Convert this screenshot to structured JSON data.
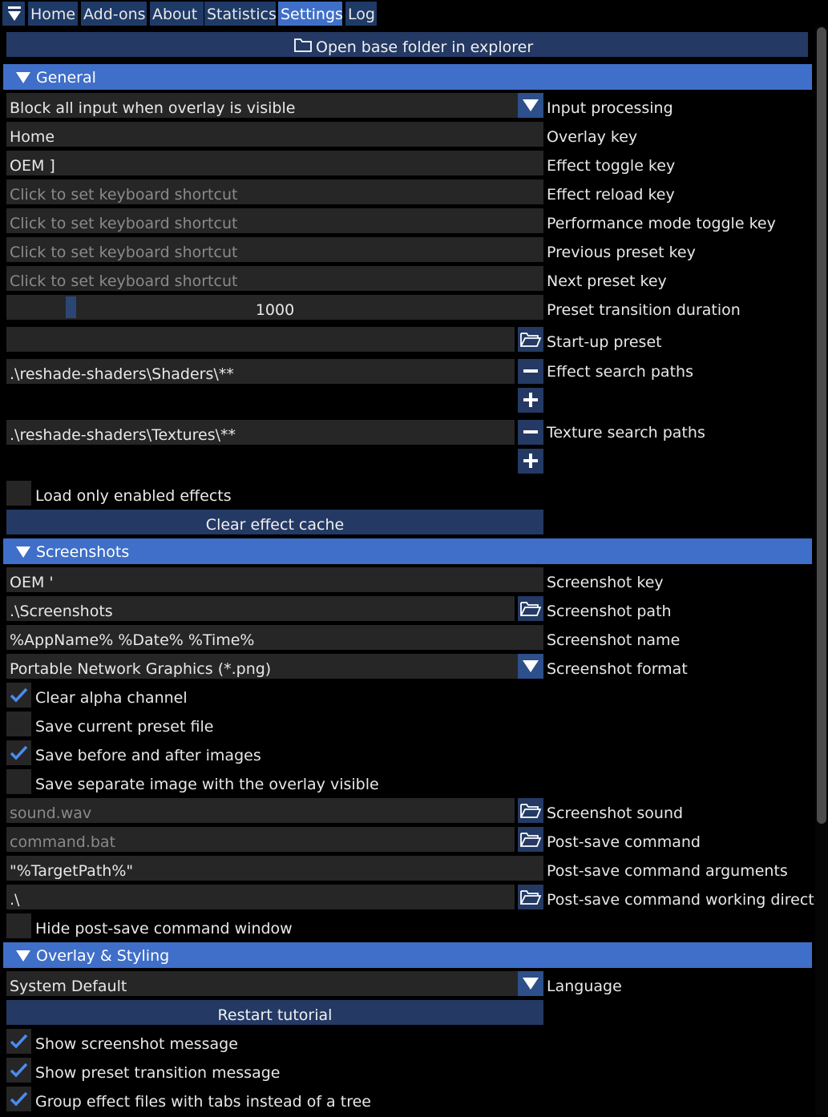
{
  "tabs": [
    "Home",
    "Add-ons",
    "About",
    "Statistics",
    "Settings",
    "Log"
  ],
  "active_tab": "Settings",
  "open_folder_label": "Open base folder in explorer",
  "general": {
    "header": "General",
    "input_processing": {
      "value": "Block all input when overlay is visible",
      "label": "Input processing"
    },
    "overlay_key": {
      "value": "Home",
      "label": "Overlay key"
    },
    "effect_toggle_key": {
      "value": "OEM ]",
      "label": "Effect toggle key"
    },
    "effect_reload_key": {
      "placeholder": "Click to set keyboard shortcut",
      "label": "Effect reload key"
    },
    "performance_mode_key": {
      "placeholder": "Click to set keyboard shortcut",
      "label": "Performance mode toggle key"
    },
    "previous_preset_key": {
      "placeholder": "Click to set keyboard shortcut",
      "label": "Previous preset key"
    },
    "next_preset_key": {
      "placeholder": "Click to set keyboard shortcut",
      "label": "Next preset key"
    },
    "preset_transition": {
      "value": "1000",
      "label": "Preset transition duration"
    },
    "startup_preset": {
      "value": "",
      "label": "Start-up preset"
    },
    "effect_search_paths": {
      "value": ".\\reshade-shaders\\Shaders\\**",
      "label": "Effect search paths"
    },
    "texture_search_paths": {
      "value": ".\\reshade-shaders\\Textures\\**",
      "label": "Texture search paths"
    },
    "load_only_enabled": {
      "label": "Load only enabled effects",
      "checked": false
    },
    "clear_cache_label": "Clear effect cache"
  },
  "screenshots": {
    "header": "Screenshots",
    "screenshot_key": {
      "value": "OEM '",
      "label": "Screenshot key"
    },
    "screenshot_path": {
      "value": ".\\Screenshots",
      "label": "Screenshot path"
    },
    "screenshot_name": {
      "value": "%AppName% %Date% %Time%",
      "label": "Screenshot name"
    },
    "screenshot_format": {
      "value": "Portable Network Graphics (*.png)",
      "label": "Screenshot format"
    },
    "clear_alpha": {
      "label": "Clear alpha channel",
      "checked": true
    },
    "save_preset": {
      "label": "Save current preset file",
      "checked": false
    },
    "save_before_after": {
      "label": "Save before and after images",
      "checked": true
    },
    "save_overlay": {
      "label": "Save separate image with the overlay visible",
      "checked": false
    },
    "screenshot_sound": {
      "placeholder": "sound.wav",
      "label": "Screenshot sound"
    },
    "post_save_command": {
      "placeholder": "command.bat",
      "label": "Post-save command"
    },
    "post_save_args": {
      "value": "\"%TargetPath%\"",
      "label": "Post-save command arguments"
    },
    "post_save_dir": {
      "value": ".\\",
      "label": "Post-save command working directory"
    },
    "hide_post_save": {
      "label": "Hide post-save command window",
      "checked": false
    }
  },
  "overlay_styling": {
    "header": "Overlay & Styling",
    "language": {
      "value": "System Default",
      "label": "Language"
    },
    "restart_tutorial_label": "Restart tutorial",
    "show_screenshot_msg": {
      "label": "Show screenshot message",
      "checked": true
    },
    "show_preset_msg": {
      "label": "Show preset transition message",
      "checked": true
    },
    "group_tabs": {
      "label": "Group effect files with tabs instead of a tree",
      "checked": true
    }
  },
  "slider_fraction": 0.11,
  "colors": {
    "accent": "#3f6fc8",
    "button": "#243a64",
    "field": "#262626",
    "check": "#4a8bf0"
  }
}
